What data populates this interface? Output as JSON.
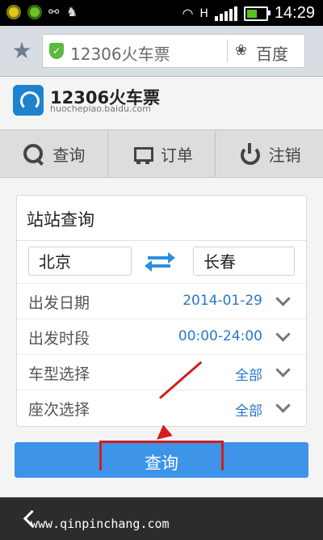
{
  "status_bar": {
    "time": "14:29"
  },
  "browser": {
    "url_text": "12306火车票",
    "search_engine": "百度"
  },
  "site": {
    "brand": "12306火车票",
    "domain": "huochepiao.baidu.com"
  },
  "nav": {
    "items": [
      {
        "label": "查询",
        "icon": "search-icon"
      },
      {
        "label": "订单",
        "icon": "cart-icon"
      },
      {
        "label": "注销",
        "icon": "power-icon"
      }
    ]
  },
  "search_card": {
    "title": "站站查询",
    "from_station": "北京",
    "to_station": "长春",
    "rows": [
      {
        "label": "出发日期",
        "value": "2014-01-29"
      },
      {
        "label": "出发时段",
        "value": "00:00-24:00"
      },
      {
        "label": "车型选择",
        "value": "全部"
      },
      {
        "label": "座次选择",
        "value": "全部"
      }
    ],
    "query_label": "查询"
  },
  "footer": {
    "watermark": "www.qinpinchang.com"
  },
  "colors": {
    "accent": "#3d94e8",
    "highlight": "#d51d1d",
    "link": "#2a78c8"
  }
}
